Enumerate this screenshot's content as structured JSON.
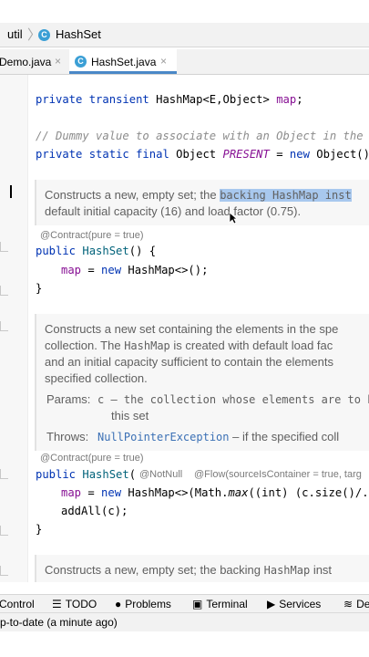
{
  "breadcrumb": {
    "package": "util",
    "class": "HashSet",
    "class_icon": "C"
  },
  "tabs": [
    {
      "label": "Demo.java",
      "close": "×"
    },
    {
      "label": "HashSet.java",
      "close": "×",
      "icon": "C"
    }
  ],
  "code": {
    "l1": {
      "kw1": "private",
      "kw2": "transient",
      "type": "HashMap<E,Object>",
      "field": "map",
      "end": ";"
    },
    "l2": {
      "comment": "// Dummy value to associate with an Object in the ba"
    },
    "l3": {
      "kw1": "private",
      "kw2": "static",
      "kw3": "final",
      "type": "Object",
      "const": "PRESENT",
      "eq": "=",
      "kwnew": "new",
      "rest": "Object();"
    },
    "doc1": {
      "t1a": "Constructs a new, empty set; the ",
      "t1hl": "backing HashMap inst",
      "t2": "default initial capacity (16) and load factor (0.75)."
    },
    "anno1": "@Contract(pure = true)",
    "c1": {
      "kw": "public",
      "name": "HashSet",
      "rest": "() {"
    },
    "c1b": {
      "field": "map",
      "rest": " = ",
      "kwnew": "new",
      "rest2": " HashMap<>();"
    },
    "c1c": "}",
    "doc2": {
      "t1": "Constructs a new set containing the elements in the spe",
      "t2": "collection. The ",
      "t2m": "HashMap",
      "t2b": " is created with default load fac",
      "t3": "and an initial capacity sufficient to contain the elements",
      "t4": "specified collection.",
      "params_label": "Params:",
      "param1": "c – the collection whose elements are to be pla",
      "param2": "this set",
      "throws_label": "Throws:",
      "throws_link": "NullPointerException",
      "throws_rest": " – if the specified coll"
    },
    "anno2": "@Contract(pure = true)",
    "c2": {
      "kw": "public",
      "name": "HashSet",
      "rest": "( ",
      "a1": "@NotNull",
      "a2": "@Flow(sourceIsContainer = true, targ"
    },
    "c2b": {
      "field": "map",
      "rest": " = ",
      "kwnew": "new",
      "rest2": " HashMap<>(Math.",
      "fn": "max",
      "rest3": "((int) (c.size()/.7"
    },
    "c2c": "addAll(c);",
    "c2d": "}",
    "doc3": {
      "t1": "Constructs a new, empty set; the backing ",
      "t1m": "HashMap",
      "t1b": " inst"
    }
  },
  "toolwindows": [
    {
      "label": "Control",
      "icon": ""
    },
    {
      "label": "TODO",
      "icon": "☰"
    },
    {
      "label": "Problems",
      "icon": "●"
    },
    {
      "label": "Terminal",
      "icon": "▣"
    },
    {
      "label": "Services",
      "icon": "▶"
    },
    {
      "label": "De",
      "icon": "≋"
    }
  ],
  "status": "p-to-date (a minute ago)"
}
